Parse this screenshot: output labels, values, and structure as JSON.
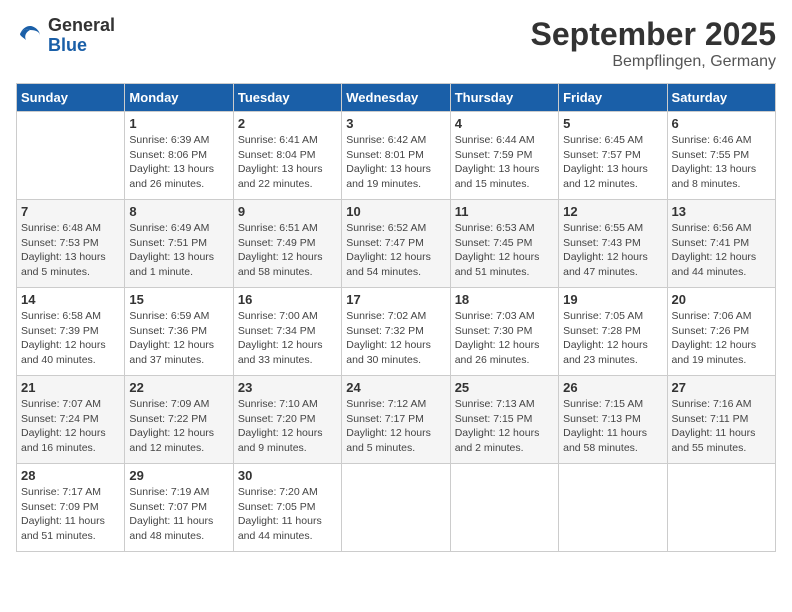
{
  "header": {
    "logo": {
      "general": "General",
      "blue": "Blue"
    },
    "title": "September 2025",
    "location": "Bempflingen, Germany"
  },
  "days_of_week": [
    "Sunday",
    "Monday",
    "Tuesday",
    "Wednesday",
    "Thursday",
    "Friday",
    "Saturday"
  ],
  "weeks": [
    [
      {
        "num": "",
        "info": ""
      },
      {
        "num": "1",
        "info": "Sunrise: 6:39 AM\nSunset: 8:06 PM\nDaylight: 13 hours\nand 26 minutes."
      },
      {
        "num": "2",
        "info": "Sunrise: 6:41 AM\nSunset: 8:04 PM\nDaylight: 13 hours\nand 22 minutes."
      },
      {
        "num": "3",
        "info": "Sunrise: 6:42 AM\nSunset: 8:01 PM\nDaylight: 13 hours\nand 19 minutes."
      },
      {
        "num": "4",
        "info": "Sunrise: 6:44 AM\nSunset: 7:59 PM\nDaylight: 13 hours\nand 15 minutes."
      },
      {
        "num": "5",
        "info": "Sunrise: 6:45 AM\nSunset: 7:57 PM\nDaylight: 13 hours\nand 12 minutes."
      },
      {
        "num": "6",
        "info": "Sunrise: 6:46 AM\nSunset: 7:55 PM\nDaylight: 13 hours\nand 8 minutes."
      }
    ],
    [
      {
        "num": "7",
        "info": "Sunrise: 6:48 AM\nSunset: 7:53 PM\nDaylight: 13 hours\nand 5 minutes."
      },
      {
        "num": "8",
        "info": "Sunrise: 6:49 AM\nSunset: 7:51 PM\nDaylight: 13 hours\nand 1 minute."
      },
      {
        "num": "9",
        "info": "Sunrise: 6:51 AM\nSunset: 7:49 PM\nDaylight: 12 hours\nand 58 minutes."
      },
      {
        "num": "10",
        "info": "Sunrise: 6:52 AM\nSunset: 7:47 PM\nDaylight: 12 hours\nand 54 minutes."
      },
      {
        "num": "11",
        "info": "Sunrise: 6:53 AM\nSunset: 7:45 PM\nDaylight: 12 hours\nand 51 minutes."
      },
      {
        "num": "12",
        "info": "Sunrise: 6:55 AM\nSunset: 7:43 PM\nDaylight: 12 hours\nand 47 minutes."
      },
      {
        "num": "13",
        "info": "Sunrise: 6:56 AM\nSunset: 7:41 PM\nDaylight: 12 hours\nand 44 minutes."
      }
    ],
    [
      {
        "num": "14",
        "info": "Sunrise: 6:58 AM\nSunset: 7:39 PM\nDaylight: 12 hours\nand 40 minutes."
      },
      {
        "num": "15",
        "info": "Sunrise: 6:59 AM\nSunset: 7:36 PM\nDaylight: 12 hours\nand 37 minutes."
      },
      {
        "num": "16",
        "info": "Sunrise: 7:00 AM\nSunset: 7:34 PM\nDaylight: 12 hours\nand 33 minutes."
      },
      {
        "num": "17",
        "info": "Sunrise: 7:02 AM\nSunset: 7:32 PM\nDaylight: 12 hours\nand 30 minutes."
      },
      {
        "num": "18",
        "info": "Sunrise: 7:03 AM\nSunset: 7:30 PM\nDaylight: 12 hours\nand 26 minutes."
      },
      {
        "num": "19",
        "info": "Sunrise: 7:05 AM\nSunset: 7:28 PM\nDaylight: 12 hours\nand 23 minutes."
      },
      {
        "num": "20",
        "info": "Sunrise: 7:06 AM\nSunset: 7:26 PM\nDaylight: 12 hours\nand 19 minutes."
      }
    ],
    [
      {
        "num": "21",
        "info": "Sunrise: 7:07 AM\nSunset: 7:24 PM\nDaylight: 12 hours\nand 16 minutes."
      },
      {
        "num": "22",
        "info": "Sunrise: 7:09 AM\nSunset: 7:22 PM\nDaylight: 12 hours\nand 12 minutes."
      },
      {
        "num": "23",
        "info": "Sunrise: 7:10 AM\nSunset: 7:20 PM\nDaylight: 12 hours\nand 9 minutes."
      },
      {
        "num": "24",
        "info": "Sunrise: 7:12 AM\nSunset: 7:17 PM\nDaylight: 12 hours\nand 5 minutes."
      },
      {
        "num": "25",
        "info": "Sunrise: 7:13 AM\nSunset: 7:15 PM\nDaylight: 12 hours\nand 2 minutes."
      },
      {
        "num": "26",
        "info": "Sunrise: 7:15 AM\nSunset: 7:13 PM\nDaylight: 11 hours\nand 58 minutes."
      },
      {
        "num": "27",
        "info": "Sunrise: 7:16 AM\nSunset: 7:11 PM\nDaylight: 11 hours\nand 55 minutes."
      }
    ],
    [
      {
        "num": "28",
        "info": "Sunrise: 7:17 AM\nSunset: 7:09 PM\nDaylight: 11 hours\nand 51 minutes."
      },
      {
        "num": "29",
        "info": "Sunrise: 7:19 AM\nSunset: 7:07 PM\nDaylight: 11 hours\nand 48 minutes."
      },
      {
        "num": "30",
        "info": "Sunrise: 7:20 AM\nSunset: 7:05 PM\nDaylight: 11 hours\nand 44 minutes."
      },
      {
        "num": "",
        "info": ""
      },
      {
        "num": "",
        "info": ""
      },
      {
        "num": "",
        "info": ""
      },
      {
        "num": "",
        "info": ""
      }
    ]
  ]
}
